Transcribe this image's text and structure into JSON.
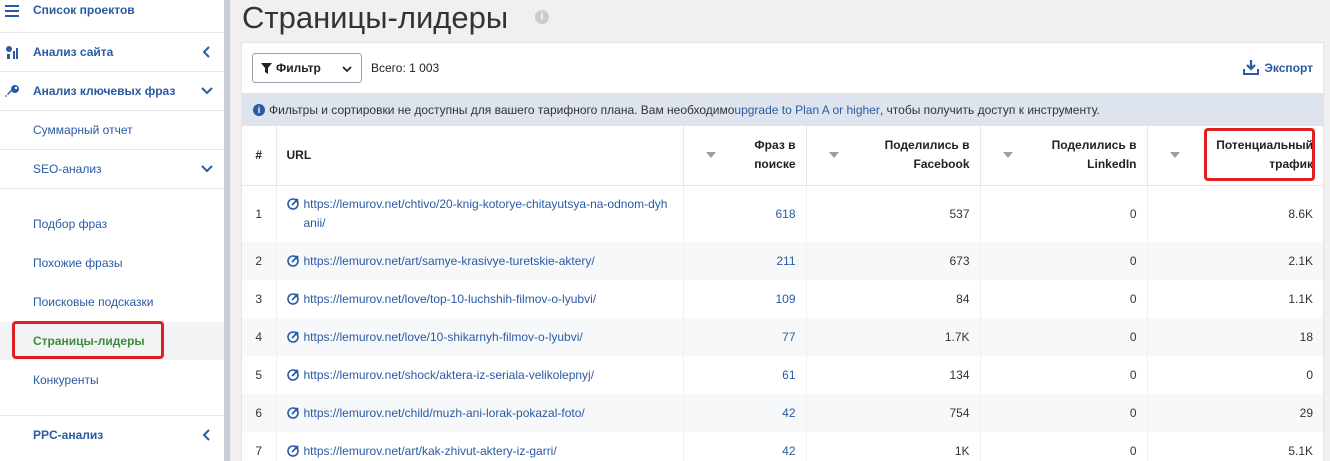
{
  "sidebar": {
    "items": [
      {
        "label": "Список проектов",
        "icon": "menu-icon"
      },
      {
        "label": "Анализ сайта",
        "icon": "site-analysis-icon"
      },
      {
        "label": "Анализ ключевых фраз",
        "icon": "key-icon"
      },
      {
        "label": "Суммарный отчет"
      },
      {
        "label": "SEO-анализ"
      },
      {
        "label": "Подбор фраз"
      },
      {
        "label": "Похожие фразы"
      },
      {
        "label": "Поисковые подсказки"
      },
      {
        "label": "Страницы-лидеры"
      },
      {
        "label": "Конкуренты"
      },
      {
        "label": "PPC-анализ"
      }
    ]
  },
  "page": {
    "title": "Страницы-лидеры"
  },
  "toolbar": {
    "filter_label": "Фильтр",
    "total": "Всего: 1 003",
    "export_label": "Экспорт"
  },
  "notice": {
    "before": "Фильтры и сортировки не доступны для вашего тарифного плана. Вам необходимо ",
    "link": "upgrade to Plan A or higher",
    "after": ", чтобы получить доступ к инструменту."
  },
  "table": {
    "headers": {
      "num": "#",
      "url": "URL",
      "phrases_1": "Фраз в",
      "phrases_2": "поиске",
      "facebook_1": "Поделились в",
      "facebook_2": "Facebook",
      "linkedin_1": "Поделились в",
      "linkedin_2": "LinkedIn",
      "traffic_1": "Потенциальный",
      "traffic_2": "трафик"
    },
    "rows": [
      {
        "num": "1",
        "url_1": "https://lemurov.net/chtivo/20-knig-kotorye-chitayutsya-na-odnom-dyh",
        "url_2": "anii/",
        "phrases": "618",
        "facebook": "537",
        "linkedin": "0",
        "traffic": "8.6K"
      },
      {
        "num": "2",
        "url_1": "https://lemurov.net/art/samye-krasivye-turetskie-aktery/",
        "url_2": "",
        "phrases": "211",
        "facebook": "673",
        "linkedin": "0",
        "traffic": "2.1K"
      },
      {
        "num": "3",
        "url_1": "https://lemurov.net/love/top-10-luchshih-filmov-o-lyubvi/",
        "url_2": "",
        "phrases": "109",
        "facebook": "84",
        "linkedin": "0",
        "traffic": "1.1K"
      },
      {
        "num": "4",
        "url_1": "https://lemurov.net/love/10-shikarnyh-filmov-o-lyubvi/",
        "url_2": "",
        "phrases": "77",
        "facebook": "1.7K",
        "linkedin": "0",
        "traffic": "18"
      },
      {
        "num": "5",
        "url_1": "https://lemurov.net/shock/aktera-iz-seriala-velikolepnyj/",
        "url_2": "",
        "phrases": "61",
        "facebook": "134",
        "linkedin": "0",
        "traffic": "0"
      },
      {
        "num": "6",
        "url_1": "https://lemurov.net/child/muzh-ani-lorak-pokazal-foto/",
        "url_2": "",
        "phrases": "42",
        "facebook": "754",
        "linkedin": "0",
        "traffic": "29"
      },
      {
        "num": "7",
        "url_1": "https://lemurov.net/art/kak-zhivut-aktery-iz-garri/",
        "url_2": "",
        "phrases": "42",
        "facebook": "1K",
        "linkedin": "0",
        "traffic": "5.1K"
      }
    ]
  },
  "colors": {
    "accent": "#2a5aa4",
    "active": "#3d8b3d",
    "highlight": "#e02020"
  }
}
